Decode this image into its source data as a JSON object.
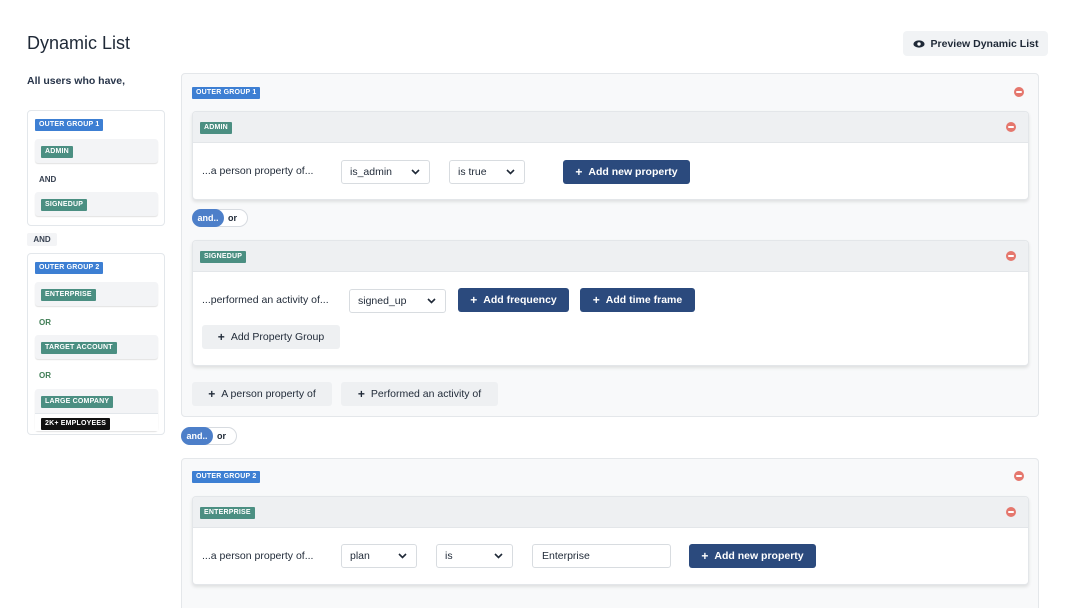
{
  "header": {
    "title": "Dynamic List",
    "preview_label": "Preview Dynamic List",
    "intro": "All users who have,"
  },
  "summary": {
    "group1": {
      "badge": "OUTER GROUP 1",
      "items": [
        "ADMIN",
        "SIGNEDUP"
      ],
      "conjunction": "AND"
    },
    "between": "AND",
    "group2": {
      "badge": "OUTER GROUP 2",
      "items": [
        "ENTERPRISE",
        "TARGET ACCOUNT",
        "LARGE COMPANY"
      ],
      "conjunctions": [
        "OR",
        "OR"
      ],
      "sub_badge": "2K+ EMPLOYEES"
    }
  },
  "main": {
    "outer1": {
      "badge": "OUTER GROUP 1",
      "admin_group": {
        "badge": "ADMIN",
        "row_label": "...a person property of...",
        "property_select": "is_admin",
        "operator_select": "is true",
        "add_property": "Add new property"
      },
      "toggle": {
        "and": "and..",
        "or": "or"
      },
      "signedup_group": {
        "badge": "SIGNEDUP",
        "row_label": "...performed an activity of...",
        "activity_select": "signed_up",
        "add_frequency": "Add frequency",
        "add_time_frame": "Add time frame",
        "add_property_group": "Add Property Group"
      },
      "add_person_property": "A person property of",
      "add_activity": "Performed an activity of"
    },
    "outer_toggle": {
      "and": "and..",
      "or": "or"
    },
    "outer2": {
      "badge": "OUTER GROUP 2",
      "enterprise_group": {
        "badge": "ENTERPRISE",
        "row_label": "...a person property of...",
        "property_select": "plan",
        "operator_select": "is",
        "value": "Enterprise",
        "add_property": "Add new property"
      }
    }
  },
  "colors": {
    "blue_badge": "#3d7fd3",
    "green_badge": "#4b8f82",
    "dark_button": "#2b4a7d",
    "remove_icon": "#e5776d",
    "toggle_active": "#4d7fc9"
  },
  "icons": {
    "preview": "eye-icon",
    "remove": "remove-circle-icon",
    "dropdown": "chevron-down-icon",
    "add": "plus-icon"
  }
}
